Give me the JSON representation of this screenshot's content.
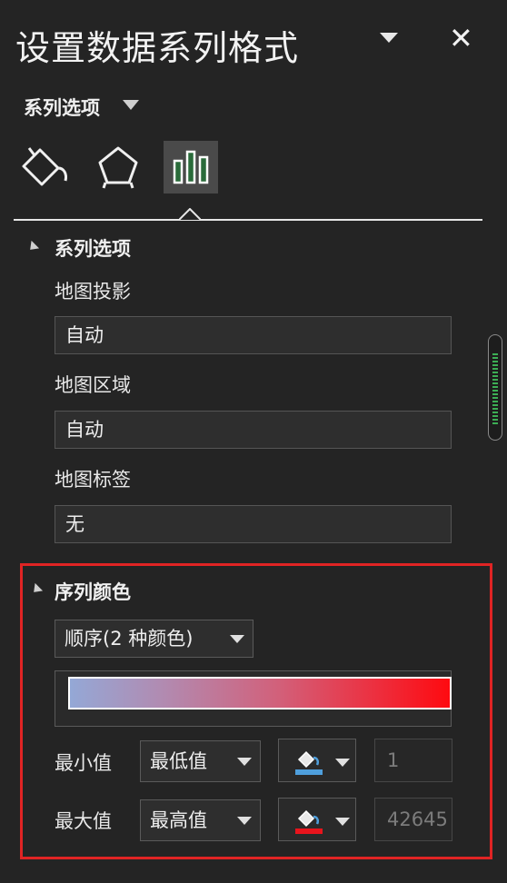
{
  "pane": {
    "title": "设置数据系列格式",
    "close_glyph": "✕",
    "section_dropdown": "系列选项"
  },
  "tabs": [
    {
      "name": "填充与线条",
      "icon": "paint-bucket-icon"
    },
    {
      "name": "效果",
      "icon": "pentagon-icon"
    },
    {
      "name": "系列选项",
      "icon": "bar-chart-icon",
      "active": true
    }
  ],
  "series_options": {
    "group_title": "系列选项",
    "map_projection": {
      "label": "地图投影",
      "value": "自动"
    },
    "map_area": {
      "label": "地图区域",
      "value": "自动"
    },
    "map_labels": {
      "label": "地图标签",
      "value": "无"
    }
  },
  "series_color": {
    "group_title": "序列颜色",
    "scheme": "顺序(2 种颜色)",
    "gradient": {
      "start_color": "#94a8d6",
      "end_color": "#fe0a10"
    },
    "min": {
      "label": "最小值",
      "type": "最低值",
      "fill_color": "#4f9fdc",
      "value": "1"
    },
    "max": {
      "label": "最大值",
      "type": "最高值",
      "fill_color": "#e8141c",
      "value": "42645"
    }
  },
  "colors": {
    "background": "#242424",
    "highlight_border": "#e02424",
    "scrollbar_thumb": "#3cae54"
  }
}
